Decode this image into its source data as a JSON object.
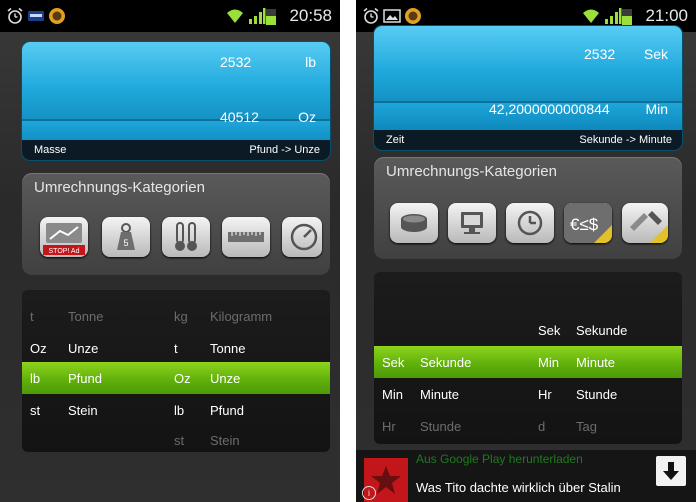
{
  "left": {
    "status_time": "20:58",
    "display": {
      "top_value": "2532",
      "top_unit": "lb",
      "bottom_value": "40512",
      "bottom_unit": "Oz",
      "category": "Masse",
      "conversion": "Pfund -> Unze"
    },
    "categories_title": "Umrechnungs-Kategorien",
    "category_icons": [
      "stop-ad-icon",
      "weight-icon",
      "thermometer-icon",
      "ruler-icon",
      "gauge-icon"
    ],
    "ad_badge": "STOP! Ad",
    "weight_badge": "5",
    "picker_rows": [
      {
        "from_abbr": "t",
        "from_name": "Tonne",
        "to_abbr": "kg",
        "to_name": "Kilogramm",
        "state": "dim"
      },
      {
        "from_abbr": "Oz",
        "from_name": "Unze",
        "to_abbr": "t",
        "to_name": "Tonne",
        "state": "normal"
      },
      {
        "from_abbr": "lb",
        "from_name": "Pfund",
        "to_abbr": "Oz",
        "to_name": "Unze",
        "state": "selected"
      },
      {
        "from_abbr": "st",
        "from_name": "Stein",
        "to_abbr": "lb",
        "to_name": "Pfund",
        "state": "normal"
      },
      {
        "from_abbr": "",
        "from_name": "",
        "to_abbr": "st",
        "to_name": "Stein",
        "state": "dim"
      }
    ]
  },
  "right": {
    "status_time": "21:00",
    "display": {
      "top_value": "2532",
      "top_unit": "Sek",
      "bottom_value": "42,2000000000844",
      "bottom_unit": "Min",
      "category": "Zeit",
      "conversion": "Sekunde -> Minute"
    },
    "categories_title": "Umrechnungs-Kategorien",
    "category_icons": [
      "storage-icon",
      "monitor-icon",
      "clock-icon",
      "currency-icon",
      "tools-icon"
    ],
    "picker_rows": [
      {
        "from_abbr": "",
        "from_name": "",
        "to_abbr": "Sek",
        "to_name": "Sekunde",
        "state": "normal"
      },
      {
        "from_abbr": "Sek",
        "from_name": "Sekunde",
        "to_abbr": "Min",
        "to_name": "Minute",
        "state": "selected"
      },
      {
        "from_abbr": "Min",
        "from_name": "Minute",
        "to_abbr": "Hr",
        "to_name": "Stunde",
        "state": "normal"
      },
      {
        "from_abbr": "Hr",
        "from_name": "Stunde",
        "to_abbr": "d",
        "to_name": "Tag",
        "state": "dim"
      }
    ],
    "ad": {
      "top_text": "Aus Google Play herunterladen",
      "text": "Was Tito dachte wirklich über Stalin"
    }
  },
  "colors": {
    "display_blue": "#1ea6da",
    "selection_green": "#6cbc10",
    "panel_gray": "#4a4a4a"
  }
}
